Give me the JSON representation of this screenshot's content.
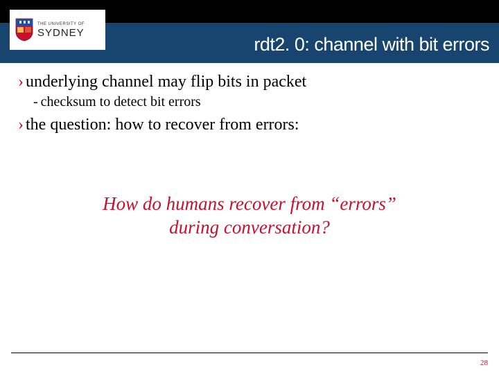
{
  "logo": {
    "prefix": "THE UNIVERSITY OF",
    "name": "SYDNEY"
  },
  "header": {
    "title": "rdt2. 0: channel with bit errors"
  },
  "bullets": {
    "b1": {
      "marker": "›",
      "text": "underlying channel may flip bits in packet"
    },
    "b2": {
      "marker": "-",
      "text": "checksum to detect bit errors"
    },
    "b3": {
      "marker": "›",
      "text": "the question: how to recover from errors:"
    }
  },
  "callout": {
    "line1": "How do humans recover from “errors”",
    "line2": "during conversation?"
  },
  "page_number": "28",
  "colors": {
    "brand_red": "#c8102e",
    "header_blue": "#17456f"
  }
}
